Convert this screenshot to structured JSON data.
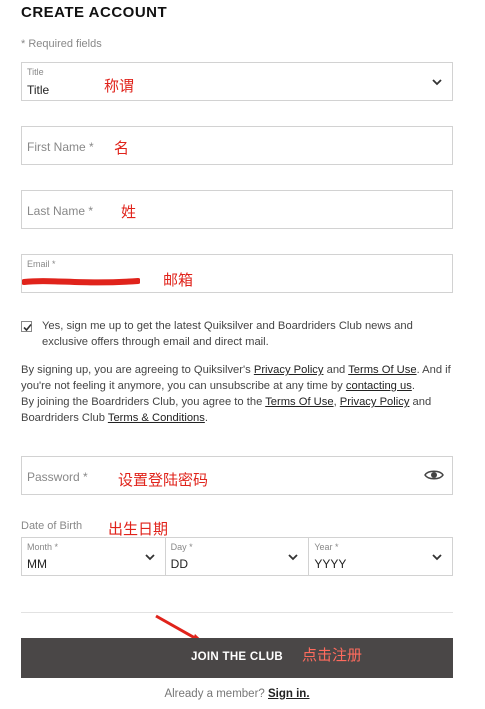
{
  "header": {
    "title": "CREATE ACCOUNT",
    "required_note": "* Required fields"
  },
  "form": {
    "title_field": {
      "label": "Title",
      "value": "Title",
      "annotation": "称谓"
    },
    "first_name": {
      "placeholder": "First Name *",
      "annotation": "名"
    },
    "last_name": {
      "placeholder": "Last Name *",
      "annotation": "姓"
    },
    "email": {
      "label": "Email *",
      "annotation": "邮箱"
    },
    "newsletter": {
      "checked": true,
      "text": "Yes, sign me up to get the latest Quiksilver and Boardriders Club news and exclusive offers through email and direct mail."
    },
    "legal": {
      "p1_a": "By signing up, you are agreeing to Quiksilver's ",
      "privacy_policy": "Privacy Policy",
      "and": " and ",
      "terms_of_use": "Terms Of Use",
      "p1_b": ". And if you're not feeling it anymore, you can unsubscribe at any time by ",
      "contacting_us": "contacting us",
      "p1_c": ".",
      "p2_a": "By joining the Boardriders Club, you agree to the ",
      "terms_of_use_2": "Terms Of Use",
      "comma": ", ",
      "privacy_policy_2": "Privacy Policy",
      "p2_b": " and Boardriders Club ",
      "terms_conditions": "Terms & Conditions",
      "p2_c": "."
    },
    "password": {
      "placeholder": "Password *",
      "annotation": "设置登陆密码"
    },
    "dob": {
      "label": "Date of Birth",
      "annotation": "出生日期",
      "month": {
        "label": "Month *",
        "value": "MM"
      },
      "day": {
        "label": "Day *",
        "value": "DD"
      },
      "year": {
        "label": "Year *",
        "value": "YYYY"
      }
    },
    "submit": {
      "label": "JOIN THE CLUB",
      "annotation": "点击注册"
    },
    "footer": {
      "prefix": "Already a member? ",
      "signin": "Sign in."
    }
  },
  "colors": {
    "annotation_red": "#e0231b",
    "button_bg": "#4a4747",
    "border": "#d2d2d2"
  },
  "icons": {
    "title_dropdown": "chevron-down-icon",
    "password_toggle": "eye-icon",
    "checkbox": "checkmark-icon"
  }
}
